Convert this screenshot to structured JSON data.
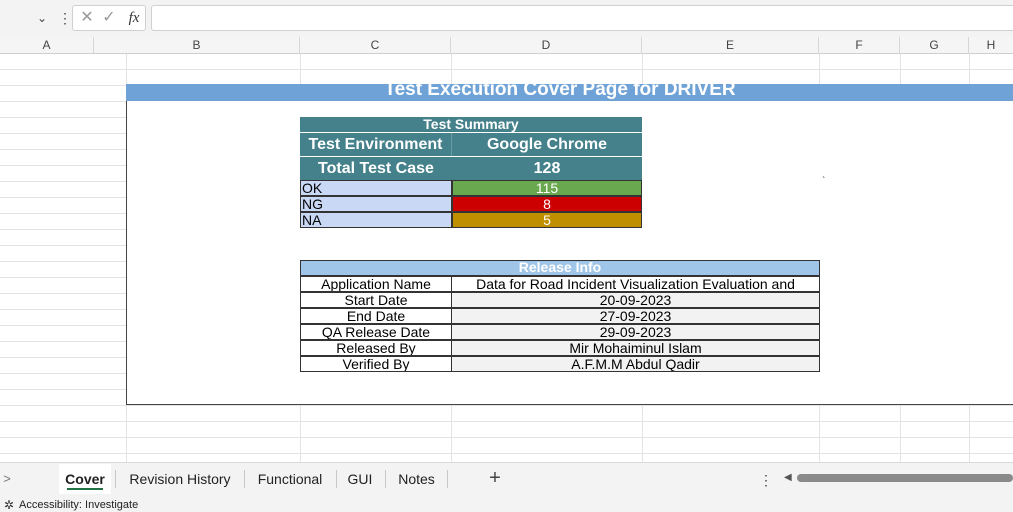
{
  "formula_bar": {
    "fx_label": "fx",
    "cancel_icon": "✕",
    "enter_icon": "✓",
    "dots": "⋮",
    "namebox_arrow": "⌄"
  },
  "columns": [
    "A",
    "B",
    "C",
    "D",
    "E",
    "F",
    "G",
    "H"
  ],
  "cover": {
    "title": "Test Execution Cover Page for DRIVER",
    "title_bar_color": "#6fa2d6"
  },
  "test_summary": {
    "header": "Test Summary",
    "environment_label": "Test Environment",
    "environment_value": "Google Chrome",
    "total_label": "Total Test Case",
    "total_value": "128",
    "rows": [
      {
        "label": "OK",
        "value": "115",
        "color": "#6aa84f"
      },
      {
        "label": "NG",
        "value": "8",
        "color": "#cc0000"
      },
      {
        "label": "NA",
        "value": "5",
        "color": "#bf8f00"
      }
    ],
    "header_color": "#44818b"
  },
  "release_info": {
    "header": "Release Info",
    "rows": [
      {
        "label": "Application Name",
        "value": "Data for Road Incident Visualization Evaluation and"
      },
      {
        "label": "Start Date",
        "value": "20-09-2023"
      },
      {
        "label": "End Date",
        "value": "27-09-2023"
      },
      {
        "label": "QA Release Date",
        "value": "29-09-2023"
      },
      {
        "label": "Released By",
        "value": "Mir Mohaiminul Islam"
      },
      {
        "label": "Verified By",
        "value": "A.F.M.M Abdul Qadir"
      }
    ]
  },
  "sheet_tabs": {
    "nav_icon": ">",
    "tabs": [
      "Cover",
      "Revision History",
      "Functional",
      "GUI",
      "Notes"
    ],
    "active": "Cover",
    "add_icon": "+",
    "more_icon": "⋮",
    "accent_color": "#217346"
  },
  "status_bar": {
    "accessibility_text": "Accessibility: Investigate"
  }
}
